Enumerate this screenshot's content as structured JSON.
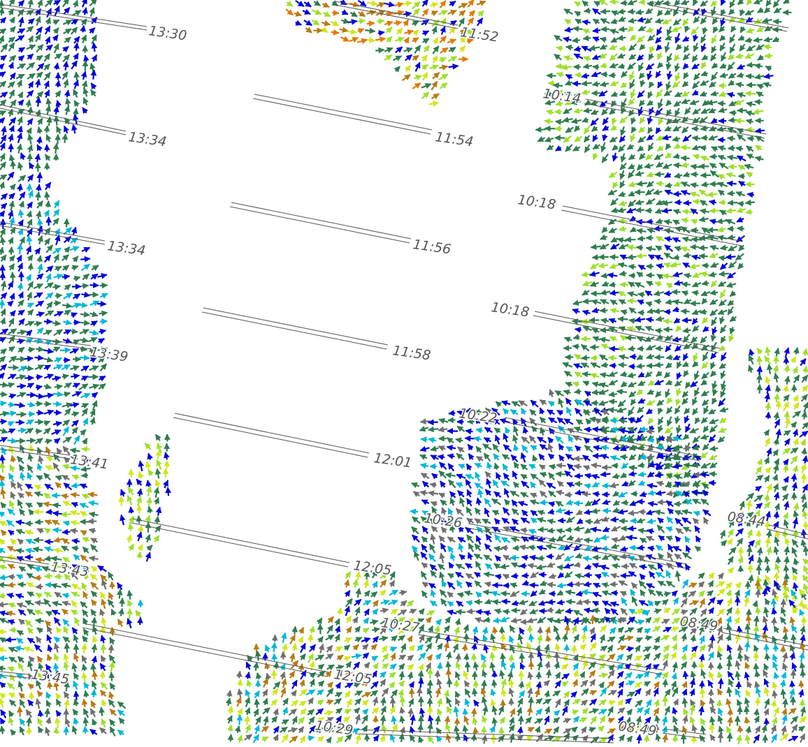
{
  "colors": {
    "background": "#ffffff",
    "speed_scale": [
      "#6f6f6f",
      "#00b8d8",
      "#0000dd",
      "#2e7d4f",
      "#3b8a4a",
      "#9de02a",
      "#cfe81a",
      "#b87a14",
      "#e07a00",
      "#ffcc00"
    ],
    "swath_fill": "#ffffff",
    "swath_edge": "#555555"
  },
  "time_labels": {
    "t1330": "13:30",
    "t1334a": "13:34",
    "t1334b": "13:34",
    "t1339": "13:39",
    "t1341": "13:41",
    "t1343": "13:43",
    "t1345": "13:45",
    "t1152": "11:52",
    "t1154": "11:54",
    "t1156": "11:56",
    "t1158": "11:58",
    "t1201": "12:01",
    "t1205a": "12:05",
    "t1205b": "12:05",
    "t1014": "10:14",
    "t1018a": "10:18",
    "t1018b": "10:18",
    "t1022": "10:22",
    "t1026": "10:26",
    "t1027": "10:27",
    "t1029": "10:29",
    "t0844": "08:44",
    "t0849a": "08:49",
    "t0849b": "08:49"
  },
  "icons": {
    "wind_vector": "arrow-glyph"
  }
}
